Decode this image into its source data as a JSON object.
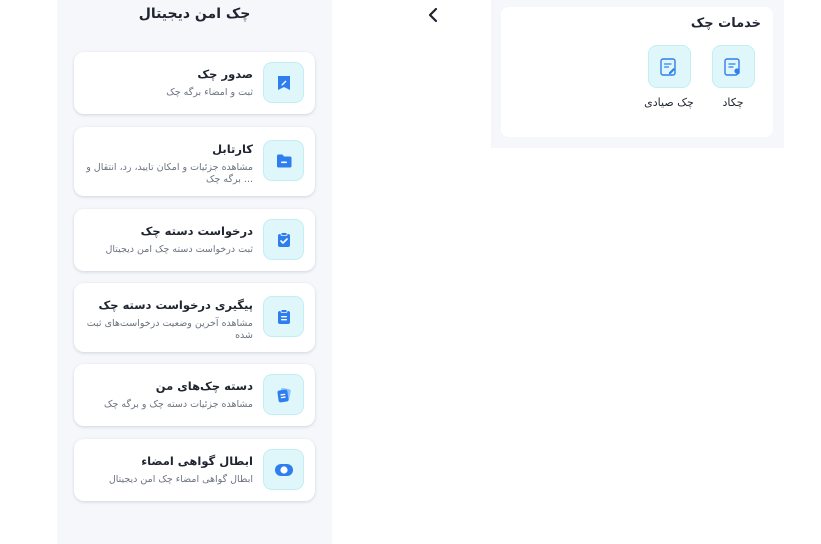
{
  "digital_cheque": {
    "title": "چک امن دیجیتال",
    "items": [
      {
        "title": "صدور چک",
        "subtitle": "ثبت و امضاء برگه چک",
        "icon": "cheque-edit-icon"
      },
      {
        "title": "کارتابل",
        "subtitle": "مشاهده جزئیات و امکان تایید، رد، انتقال و ... برگه چک",
        "icon": "folder-icon"
      },
      {
        "title": "درخواست دسته چک",
        "subtitle": "ثبت درخواست دسته چک امن دیجیتال",
        "icon": "clipboard-check-icon"
      },
      {
        "title": "پیگیری درخواست دسته چک",
        "subtitle": "مشاهده آخرین وضعیت درخواست‌های ثبت شده",
        "icon": "clipboard-list-icon"
      },
      {
        "title": "دسته چک‌های من",
        "subtitle": "مشاهده جزئیات دسته چک و برگه چک",
        "icon": "cheque-stack-icon"
      },
      {
        "title": "ابطال گواهی امضاء",
        "subtitle": "ابطال گواهی امضاء چک امن دیجیتال",
        "icon": "toggle-icon"
      }
    ]
  },
  "navigation": {
    "back_icon": "chevron-left-icon"
  },
  "cheque_services": {
    "title": "خدمات چک",
    "items": [
      {
        "label": "چکاد",
        "icon": "document-badge-icon"
      },
      {
        "label": "چک صیادی",
        "icon": "document-edit-icon"
      }
    ]
  },
  "colors": {
    "accent": "#2f7ef0",
    "icon_bg": "#dff7fa",
    "panel_bg": "#f5f7fb"
  }
}
